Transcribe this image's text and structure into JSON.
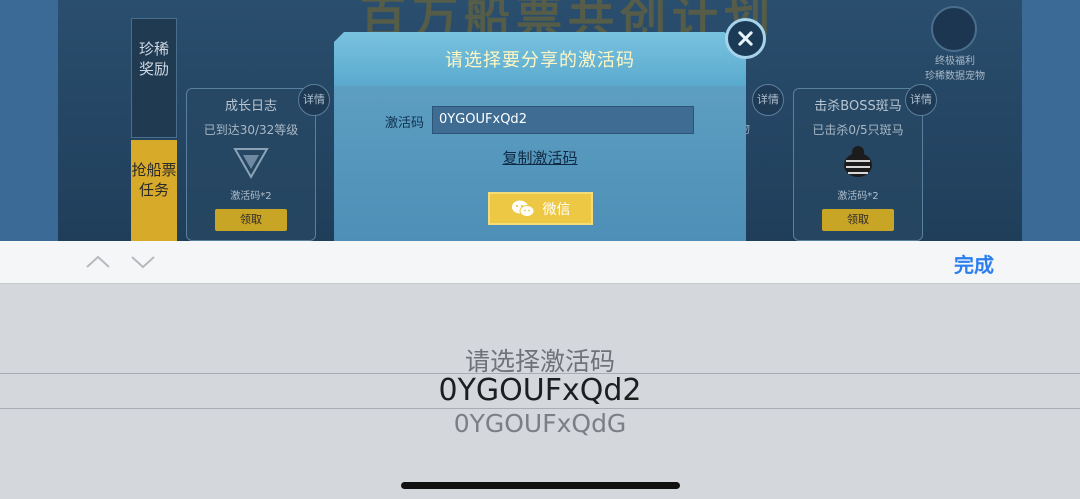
{
  "game": {
    "banner_title": "百万船票共创计划",
    "tabs": [
      "珍稀奖励",
      "抢船票任务"
    ],
    "cards": [
      {
        "title": "成长日志",
        "progress": "已到达30/32等级",
        "reward": "激活码*2",
        "button": "领取"
      },
      {
        "title": "击杀BOSS斑马",
        "progress": "已击杀0/5只斑马",
        "reward": "激活码*2",
        "button": "领取"
      }
    ],
    "detail_label": "详情",
    "top_right_caption_1": "终极福利",
    "top_right_caption_2": "珍稀数据宠物",
    "stub_text": "物"
  },
  "modal": {
    "title": "请选择要分享的激活码",
    "code_label": "激活码",
    "code_value": "0YGOUFxQd2",
    "copy_label": "复制激活码",
    "share_label": "微信",
    "close_icon": "close-icon"
  },
  "toolbar": {
    "done_label": "完成",
    "prev_icon": "chevron-up-icon",
    "next_icon": "chevron-down-icon"
  },
  "picker": {
    "items": [
      "请选择激活码",
      "0YGOUFxQd2",
      "0YGOUFxQdG"
    ],
    "selected_index": 1
  },
  "colors": {
    "accent_blue": "#2a7ef0",
    "modal_title": "#fff6c2",
    "wechat_button": "#ecc845"
  }
}
